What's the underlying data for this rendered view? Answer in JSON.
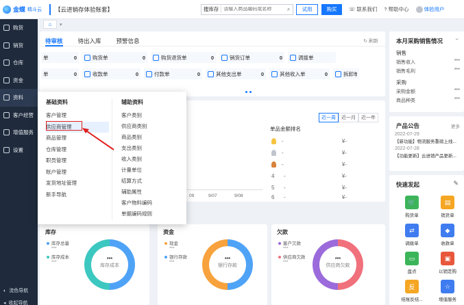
{
  "header": {
    "logo_text": "金蝶",
    "logo_sub": "精斗云",
    "account": "【云进销存体验账套】",
    "search_select": "搜库存",
    "search_placeholder": "请输入商品编码或名称",
    "trial_label": "试用",
    "buy_label": "购买",
    "contact_label": "联系我们",
    "help_label": "帮助中心",
    "user_label": "体验用户"
  },
  "sidebar": {
    "items": [
      {
        "label": "购货"
      },
      {
        "label": "销货"
      },
      {
        "label": "仓库"
      },
      {
        "label": "资金"
      },
      {
        "label": "资料"
      },
      {
        "label": "客户经营"
      },
      {
        "label": "增值服务"
      },
      {
        "label": "设置"
      }
    ],
    "bottom1": "流色导航",
    "bottom2": "收起导航"
  },
  "tabbar": {
    "home_icon": "home-icon",
    "more": "▾"
  },
  "main": {
    "tabs": [
      {
        "label": "待审核"
      },
      {
        "label": "待出入库"
      },
      {
        "label": "预警信息"
      }
    ],
    "refresh_label": "刷新",
    "docs_row1": [
      {
        "label": "单",
        "value": "0"
      },
      {
        "label": "购货单",
        "value": "0"
      },
      {
        "label": "购货退货单",
        "value": "0"
      },
      {
        "label": "销货订单",
        "value": "0"
      },
      {
        "label": "调拨单",
        "value": ""
      }
    ],
    "docs_row2": [
      {
        "label": "单",
        "value": "0"
      },
      {
        "label": "收款单",
        "value": "0"
      },
      {
        "label": "付款单",
        "value": "0"
      },
      {
        "label": "其他支出单",
        "value": "0"
      },
      {
        "label": "其他收入单",
        "value": "0"
      },
      {
        "label": "拆卸单",
        "value": ""
      }
    ]
  },
  "chart": {
    "segments": [
      "近一周",
      "近一月",
      "近一年"
    ],
    "rank_title": "单品金额排名",
    "ranks": [
      {
        "rank": "",
        "name": "-",
        "value": "¥-"
      },
      {
        "rank": "",
        "name": "-",
        "value": "¥-"
      },
      {
        "rank": "",
        "name": "-",
        "value": "¥-"
      },
      {
        "rank": "4",
        "name": "-",
        "value": "¥-"
      },
      {
        "rank": "5",
        "name": "-",
        "value": "¥-"
      },
      {
        "rank": "6",
        "name": "-",
        "value": "¥-"
      }
    ],
    "x_ticks": [
      "09",
      "9/07",
      "9/08"
    ]
  },
  "summary": [
    {
      "title": "库存",
      "legend": [
        {
          "label": "库存总量",
          "value": "***"
        },
        {
          "label": "库存成本",
          "value": "***"
        }
      ],
      "center_value": "***",
      "center_label": "库存成本"
    },
    {
      "title": "资金",
      "legend": [
        {
          "label": "现金",
          "value": "***"
        },
        {
          "label": "银行存款",
          "value": "***"
        }
      ],
      "center_value": "***",
      "center_label": "银行存款"
    },
    {
      "title": "欠款",
      "legend": [
        {
          "label": "客户欠款",
          "value": "***"
        },
        {
          "label": "供应商欠款",
          "value": "***"
        }
      ],
      "center_value": "***",
      "center_label": "供应商欠款"
    }
  ],
  "right_sales": {
    "title": "本月采购销售情况",
    "sales_label": "销售",
    "sales_kv": [
      {
        "k": "销售收入",
        "v": "***"
      },
      {
        "k": "销售毛利",
        "v": "***"
      }
    ],
    "purchase_label": "采购",
    "purchase_kv": [
      {
        "k": "采购金额",
        "v": "***"
      },
      {
        "k": "商品种类",
        "v": "***"
      }
    ]
  },
  "announce": {
    "title": "产品公告",
    "more": "更多",
    "items": [
      {
        "date": "2022-07-29",
        "text": "【新功能】物流服务重磅上线..."
      },
      {
        "date": "2022-07-28",
        "text": "【功能更新】云进销产品更新..."
      }
    ]
  },
  "quick": {
    "title": "快速发起",
    "items": [
      {
        "label": "购货单",
        "color": "#3cb55a",
        "glyph": "🛒"
      },
      {
        "label": "销货单",
        "color": "#f5a623",
        "glyph": "🛍"
      },
      {
        "label": "调拨单",
        "color": "#3f7cf0",
        "glyph": "⇄"
      },
      {
        "label": "收款单",
        "color": "#3f7cf0",
        "glyph": "◆"
      },
      {
        "label": "盘点",
        "color": "#3cb55a",
        "glyph": "▭"
      },
      {
        "label": "以销定购",
        "color": "#e8573c",
        "glyph": "▣"
      },
      {
        "label": "结账反结...",
        "color": "#f5a623",
        "glyph": "反"
      },
      {
        "label": "增值服务",
        "color": "#3f7cf0",
        "glyph": "☆"
      }
    ]
  },
  "menu": {
    "col1_title": "基础资料",
    "col1": [
      "客户管理",
      "供应商管理",
      "商品管理",
      "仓库管理",
      "职员管理",
      "账户管理",
      "发货地址管理",
      "新手导航"
    ],
    "col2_title": "辅助资料",
    "col2": [
      "客户类别",
      "供应商类别",
      "商品类别",
      "支出类别",
      "收入类别",
      "计量单位",
      "结算方式",
      "辅助属性",
      "客户物料编码",
      "单据编码规则"
    ]
  }
}
